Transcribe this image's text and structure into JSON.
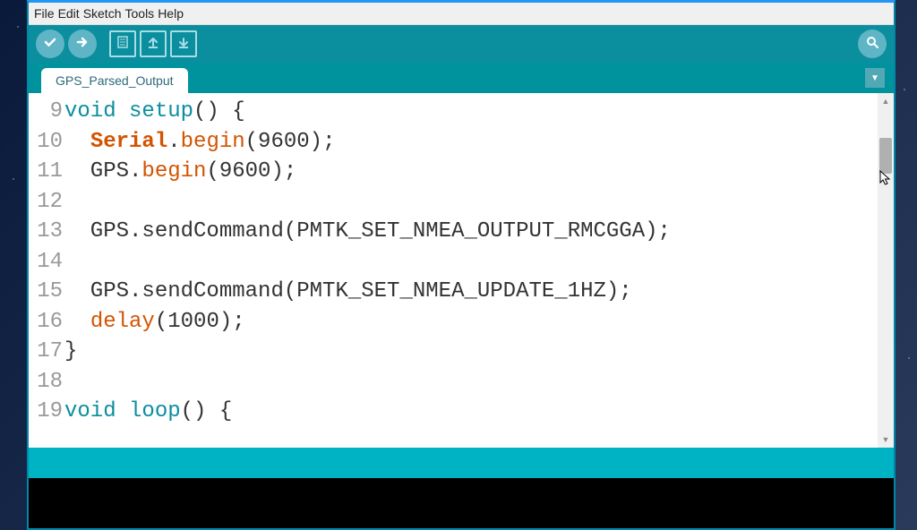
{
  "menu": {
    "file": "File",
    "edit": "Edit",
    "sketch": "Sketch",
    "tools": "Tools",
    "help": "Help"
  },
  "toolbar": {
    "verify": "verify",
    "upload": "upload",
    "new": "new",
    "open": "open",
    "save": "save",
    "serial": "serial-monitor"
  },
  "tab": {
    "name": "GPS_Parsed_Output"
  },
  "code": {
    "lines": [
      {
        "n": "9",
        "tokens": [
          {
            "t": "void ",
            "c": "kw-type"
          },
          {
            "t": "setup",
            "c": "kw-type"
          },
          {
            "t": "() {"
          }
        ]
      },
      {
        "n": "10",
        "tokens": [
          {
            "t": "  "
          },
          {
            "t": "Serial",
            "c": "kw-orange"
          },
          {
            "t": "."
          },
          {
            "t": "begin",
            "c": "kw-fn"
          },
          {
            "t": "(9600);"
          }
        ]
      },
      {
        "n": "11",
        "tokens": [
          {
            "t": "  GPS."
          },
          {
            "t": "begin",
            "c": "kw-fn"
          },
          {
            "t": "(9600);"
          }
        ]
      },
      {
        "n": "12",
        "tokens": [
          {
            "t": ""
          }
        ]
      },
      {
        "n": "13",
        "tokens": [
          {
            "t": "  GPS.sendCommand(PMTK_SET_NMEA_OUTPUT_RMCGGA);"
          }
        ]
      },
      {
        "n": "14",
        "tokens": [
          {
            "t": ""
          }
        ]
      },
      {
        "n": "15",
        "tokens": [
          {
            "t": "  GPS.sendCommand(PMTK_SET_NMEA_UPDATE_1HZ);"
          }
        ]
      },
      {
        "n": "16",
        "tokens": [
          {
            "t": "  "
          },
          {
            "t": "delay",
            "c": "kw-fn"
          },
          {
            "t": "(1000);"
          }
        ]
      },
      {
        "n": "17",
        "tokens": [
          {
            "t": "}"
          }
        ]
      },
      {
        "n": "18",
        "tokens": [
          {
            "t": ""
          }
        ]
      },
      {
        "n": "19",
        "tokens": [
          {
            "t": "void ",
            "c": "kw-type"
          },
          {
            "t": "loop",
            "c": "kw-type"
          },
          {
            "t": "() {"
          }
        ]
      }
    ]
  },
  "colors": {
    "toolbar_bg": "#0b8e9e",
    "tabstrip_bg": "#00939e",
    "status_bg": "#00b3c4",
    "accent_blue": "#2196f3",
    "keyword_teal": "#0b8e9e",
    "keyword_orange": "#d35400"
  }
}
